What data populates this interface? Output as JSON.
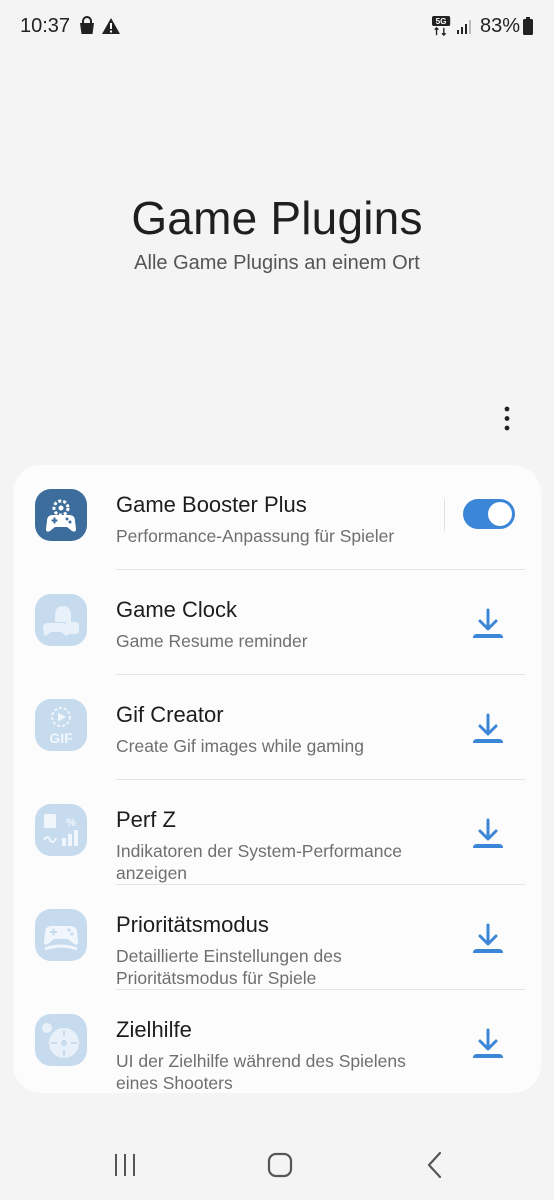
{
  "status_bar": {
    "time": "10:37",
    "network": "5G",
    "battery": "83%"
  },
  "header": {
    "title": "Game Plugins",
    "subtitle": "Alle Game Plugins an einem Ort"
  },
  "plugins": [
    {
      "name": "Game Booster Plus",
      "description": "Performance-Anpassung für Spieler",
      "action": "toggle",
      "toggle_on": true,
      "icon": "game-booster-icon"
    },
    {
      "name": "Game Clock",
      "description": "Game Resume reminder",
      "action": "download",
      "icon": "game-clock-icon"
    },
    {
      "name": "Gif Creator",
      "description": "Create Gif images while gaming",
      "action": "download",
      "icon": "gif-creator-icon"
    },
    {
      "name": "Perf Z",
      "description": "Indikatoren der System-Performance anzeigen",
      "action": "download",
      "icon": "perf-z-icon"
    },
    {
      "name": "Prioritätsmodus",
      "description": "Detaillierte Einstellungen des Prioritätsmodus für Spiele",
      "action": "download",
      "icon": "priority-mode-icon"
    },
    {
      "name": "Zielhilfe",
      "description": "UI der Zielhilfe während des Spielens eines Shooters",
      "action": "download",
      "icon": "aim-assist-icon"
    }
  ],
  "colors": {
    "accent": "#3c86d8",
    "background": "#f4f4f4",
    "card": "#fcfcfc"
  }
}
